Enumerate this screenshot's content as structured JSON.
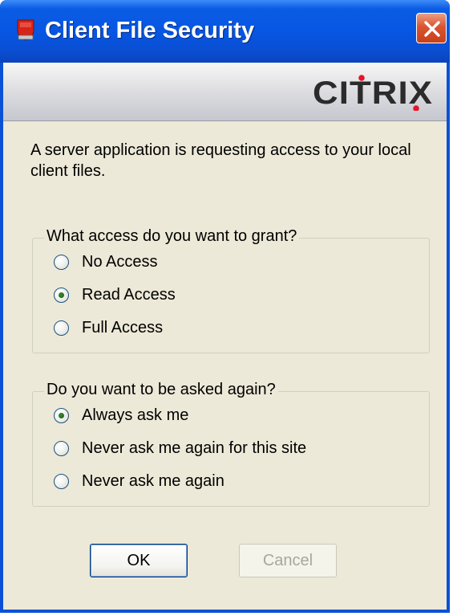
{
  "window": {
    "title": "Client File Security",
    "close_icon": "close-icon",
    "app_icon": "shield-icon",
    "colors": {
      "titlebar": "#0756e4",
      "close": "#d95530",
      "face": "#ece9d8"
    }
  },
  "banner": {
    "logo_text": "CITRIX",
    "logo_color": "#2b2b2b",
    "logo_dot_color": "#e5142a"
  },
  "message": "A server application is requesting access to your local client files.",
  "access_group": {
    "legend": "What access do you want to grant?",
    "options": [
      {
        "label": "No Access",
        "checked": false
      },
      {
        "label": "Read Access",
        "checked": true
      },
      {
        "label": "Full Access",
        "checked": false
      }
    ]
  },
  "ask_group": {
    "legend": "Do you want to be asked again?",
    "options": [
      {
        "label": "Always ask me",
        "checked": true
      },
      {
        "label": "Never ask me again for this site",
        "checked": false
      },
      {
        "label": "Never ask me again",
        "checked": false
      }
    ]
  },
  "buttons": {
    "ok_label": "OK",
    "cancel_label": "Cancel",
    "cancel_enabled": false
  }
}
